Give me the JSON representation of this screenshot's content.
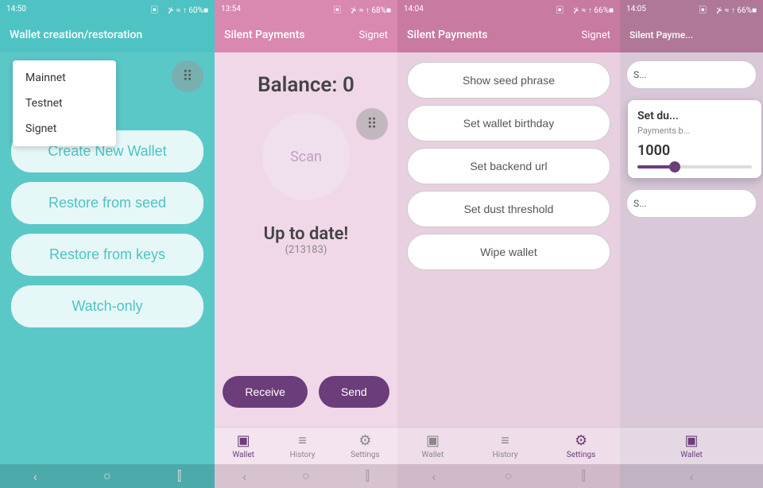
{
  "screens": [
    {
      "id": "wallet-creation",
      "status": {
        "time": "14:50",
        "icon": "✱",
        "signal": "▣ ᅟ⊁ ≈ ↑ 60%■"
      },
      "appBar": {
        "title": "Wallet creation/restoration",
        "action": ""
      },
      "dropdown": {
        "items": [
          "Mainnet",
          "Testnet",
          "Signet"
        ]
      },
      "buttons": [
        "Create New Wallet",
        "Restore from seed",
        "Restore from keys",
        "Watch-only"
      ]
    },
    {
      "id": "silent-payments-balance",
      "status": {
        "time": "13:54",
        "icon": "✱",
        "signal": "▣ ᅟ⊁ ≈ ↑ 68%■"
      },
      "appBar": {
        "title": "Silent Payments",
        "action": "Signet"
      },
      "balance": "Balance: 0",
      "scanLabel": "Scan",
      "upToDate": "Up to date!",
      "blockNumber": "(213183)",
      "receiveLabel": "Receive",
      "sendLabel": "Send",
      "nav": [
        {
          "icon": "▣",
          "label": "Wallet",
          "active": true
        },
        {
          "icon": "≡",
          "label": "History",
          "active": false
        },
        {
          "icon": "⚙",
          "label": "Settings",
          "active": false
        }
      ]
    },
    {
      "id": "silent-payments-settings",
      "status": {
        "time": "14:04",
        "icon": "✱",
        "signal": "▣ ᅟ⊁ ≈ ↑ 66%■"
      },
      "appBar": {
        "title": "Silent Payments",
        "action": "Signet"
      },
      "settingsButtons": [
        "Show seed phrase",
        "Set wallet birthday",
        "Set backend url",
        "Set dust threshold",
        "Wipe wallet"
      ],
      "nav": [
        {
          "icon": "▣",
          "label": "Wallet",
          "active": false
        },
        {
          "icon": "≡",
          "label": "History",
          "active": false
        },
        {
          "icon": "⚙",
          "label": "Settings",
          "active": true
        }
      ]
    },
    {
      "id": "silent-payments-partial",
      "status": {
        "time": "14:05",
        "icon": "✱",
        "signal": "▣ ᅟ⊁ ≈ ↑ 66%■"
      },
      "appBar": {
        "title": "Silent Payme...",
        "action": ""
      },
      "partialButtons": [
        "S",
        "S"
      ],
      "popup": {
        "title": "Set du...",
        "sub": "Payments b...",
        "value": "1000"
      },
      "nav": [
        {
          "icon": "▣",
          "label": "Wallet",
          "active": true
        }
      ]
    }
  ],
  "systemNav": {
    "buttons": [
      "‹",
      "○",
      "⫿"
    ]
  }
}
